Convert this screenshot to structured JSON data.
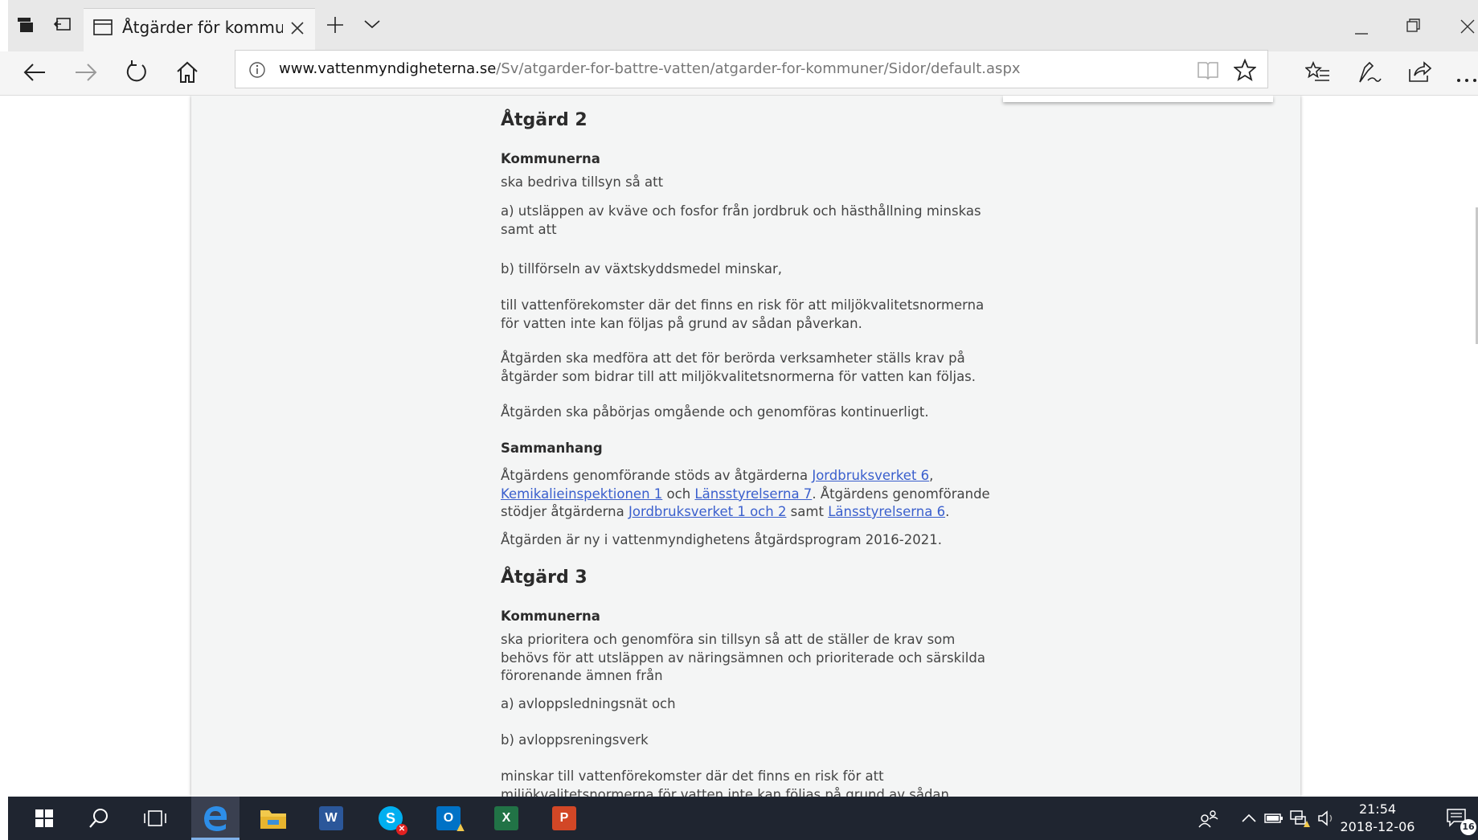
{
  "browser": {
    "tab_title": "Åtgärder för kommuner",
    "url_host": "www.vattenmyndigheterna.se",
    "url_path": "/Sv/atgarder-for-battre-vatten/atgarder-for-kommuner/Sidor/default.aspx",
    "icons": [
      "tab-actions-icon",
      "set-aside-tabs-icon",
      "tab-page-icon",
      "close-tab-icon",
      "new-tab-icon",
      "tab-list-icon",
      "minimize-icon",
      "restore-icon",
      "close-window-icon",
      "back-icon",
      "forward-icon",
      "refresh-icon",
      "home-icon",
      "info-icon",
      "reading-view-icon",
      "favorite-star-icon",
      "favorites-hub-icon",
      "pen-icon",
      "share-icon",
      "more-icon"
    ]
  },
  "article": {
    "atgard2": {
      "heading": "Åtgärd 2",
      "subheading": "Kommunerna",
      "p1": "ska bedriva tillsyn så att",
      "p2": "a) utsläppen av kväve och fosfor från jordbruk och hästhållning minskas samt att",
      "p3": "b) tillförseln av växtskyddsmedel minskar,",
      "p4": "till vattenförekomster där det finns en risk för att miljökvalitetsnormerna för vatten inte kan följas på grund av sådan påverkan.",
      "p5": "Åtgärden ska medföra att det för berörda verksamheter ställs krav på åtgärder som bidrar till att miljökvalitetsnormerna för vatten kan följas.",
      "p6": "Åtgärden ska påbörjas omgående och genomföras kontinuerligt.",
      "context_heading": "Sammanhang",
      "context_t1": "Åtgärdens genomförande stöds av åtgärderna ",
      "context_link1": "Jordbruksverket 6",
      "context_t2": ", ",
      "context_link2": "Kemikalieinspektionen 1",
      "context_t3": " och ",
      "context_link3": "Länsstyrelserna 7",
      "context_t4": ". Åtgärdens genomförande stödjer åtgärderna ",
      "context_link4": "Jordbruksverket 1 och 2",
      "context_t5": " samt ",
      "context_link5": "Länsstyrelserna 6",
      "context_t6": ".",
      "new_note": "Åtgärden är ny i vattenmyndighetens åtgärdsprogram 2016-2021."
    },
    "atgard3": {
      "heading": "Åtgärd 3",
      "subheading": "Kommunerna",
      "p1": "ska prioritera och genomföra sin tillsyn så att de ställer de krav som behövs för att utsläppen av näringsämnen och prioriterade och särskilda förorenande ämnen från",
      "p2": "a) avloppsledningsnät och",
      "p3": "b) avloppsreningsverk",
      "p4": "minskar till vattenförekomster där det finns en risk för att miljökvalitetsnormerna för vatten inte kan följas på grund av sådan"
    }
  },
  "taskbar": {
    "apps": [
      "start",
      "search",
      "task-view",
      "edge",
      "file-explorer",
      "word",
      "skype",
      "outlook",
      "excel",
      "powerpoint"
    ],
    "word_letter": "W",
    "outlook_letter": "O",
    "excel_letter": "X",
    "powerpoint_letter": "P",
    "time": "21:54",
    "date": "2018-12-06",
    "notification_count": "16"
  }
}
